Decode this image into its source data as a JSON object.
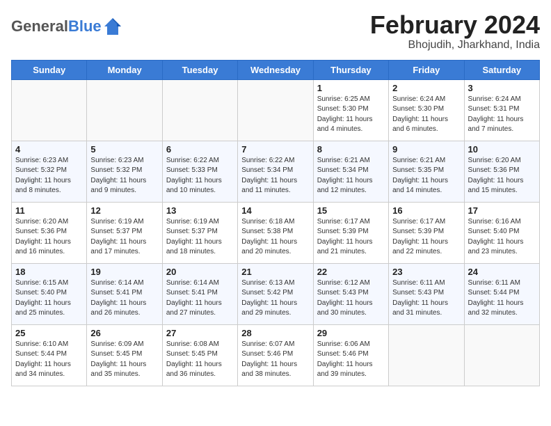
{
  "logo": {
    "general": "General",
    "blue": "Blue"
  },
  "title": "February 2024",
  "subtitle": "Bhojudih, Jharkhand, India",
  "headers": [
    "Sunday",
    "Monday",
    "Tuesday",
    "Wednesday",
    "Thursday",
    "Friday",
    "Saturday"
  ],
  "weeks": [
    [
      {
        "day": "",
        "info": ""
      },
      {
        "day": "",
        "info": ""
      },
      {
        "day": "",
        "info": ""
      },
      {
        "day": "",
        "info": ""
      },
      {
        "day": "1",
        "info": "Sunrise: 6:25 AM\nSunset: 5:30 PM\nDaylight: 11 hours\nand 4 minutes."
      },
      {
        "day": "2",
        "info": "Sunrise: 6:24 AM\nSunset: 5:30 PM\nDaylight: 11 hours\nand 6 minutes."
      },
      {
        "day": "3",
        "info": "Sunrise: 6:24 AM\nSunset: 5:31 PM\nDaylight: 11 hours\nand 7 minutes."
      }
    ],
    [
      {
        "day": "4",
        "info": "Sunrise: 6:23 AM\nSunset: 5:32 PM\nDaylight: 11 hours\nand 8 minutes."
      },
      {
        "day": "5",
        "info": "Sunrise: 6:23 AM\nSunset: 5:32 PM\nDaylight: 11 hours\nand 9 minutes."
      },
      {
        "day": "6",
        "info": "Sunrise: 6:22 AM\nSunset: 5:33 PM\nDaylight: 11 hours\nand 10 minutes."
      },
      {
        "day": "7",
        "info": "Sunrise: 6:22 AM\nSunset: 5:34 PM\nDaylight: 11 hours\nand 11 minutes."
      },
      {
        "day": "8",
        "info": "Sunrise: 6:21 AM\nSunset: 5:34 PM\nDaylight: 11 hours\nand 12 minutes."
      },
      {
        "day": "9",
        "info": "Sunrise: 6:21 AM\nSunset: 5:35 PM\nDaylight: 11 hours\nand 14 minutes."
      },
      {
        "day": "10",
        "info": "Sunrise: 6:20 AM\nSunset: 5:36 PM\nDaylight: 11 hours\nand 15 minutes."
      }
    ],
    [
      {
        "day": "11",
        "info": "Sunrise: 6:20 AM\nSunset: 5:36 PM\nDaylight: 11 hours\nand 16 minutes."
      },
      {
        "day": "12",
        "info": "Sunrise: 6:19 AM\nSunset: 5:37 PM\nDaylight: 11 hours\nand 17 minutes."
      },
      {
        "day": "13",
        "info": "Sunrise: 6:19 AM\nSunset: 5:37 PM\nDaylight: 11 hours\nand 18 minutes."
      },
      {
        "day": "14",
        "info": "Sunrise: 6:18 AM\nSunset: 5:38 PM\nDaylight: 11 hours\nand 20 minutes."
      },
      {
        "day": "15",
        "info": "Sunrise: 6:17 AM\nSunset: 5:39 PM\nDaylight: 11 hours\nand 21 minutes."
      },
      {
        "day": "16",
        "info": "Sunrise: 6:17 AM\nSunset: 5:39 PM\nDaylight: 11 hours\nand 22 minutes."
      },
      {
        "day": "17",
        "info": "Sunrise: 6:16 AM\nSunset: 5:40 PM\nDaylight: 11 hours\nand 23 minutes."
      }
    ],
    [
      {
        "day": "18",
        "info": "Sunrise: 6:15 AM\nSunset: 5:40 PM\nDaylight: 11 hours\nand 25 minutes."
      },
      {
        "day": "19",
        "info": "Sunrise: 6:14 AM\nSunset: 5:41 PM\nDaylight: 11 hours\nand 26 minutes."
      },
      {
        "day": "20",
        "info": "Sunrise: 6:14 AM\nSunset: 5:41 PM\nDaylight: 11 hours\nand 27 minutes."
      },
      {
        "day": "21",
        "info": "Sunrise: 6:13 AM\nSunset: 5:42 PM\nDaylight: 11 hours\nand 29 minutes."
      },
      {
        "day": "22",
        "info": "Sunrise: 6:12 AM\nSunset: 5:43 PM\nDaylight: 11 hours\nand 30 minutes."
      },
      {
        "day": "23",
        "info": "Sunrise: 6:11 AM\nSunset: 5:43 PM\nDaylight: 11 hours\nand 31 minutes."
      },
      {
        "day": "24",
        "info": "Sunrise: 6:11 AM\nSunset: 5:44 PM\nDaylight: 11 hours\nand 32 minutes."
      }
    ],
    [
      {
        "day": "25",
        "info": "Sunrise: 6:10 AM\nSunset: 5:44 PM\nDaylight: 11 hours\nand 34 minutes."
      },
      {
        "day": "26",
        "info": "Sunrise: 6:09 AM\nSunset: 5:45 PM\nDaylight: 11 hours\nand 35 minutes."
      },
      {
        "day": "27",
        "info": "Sunrise: 6:08 AM\nSunset: 5:45 PM\nDaylight: 11 hours\nand 36 minutes."
      },
      {
        "day": "28",
        "info": "Sunrise: 6:07 AM\nSunset: 5:46 PM\nDaylight: 11 hours\nand 38 minutes."
      },
      {
        "day": "29",
        "info": "Sunrise: 6:06 AM\nSunset: 5:46 PM\nDaylight: 11 hours\nand 39 minutes."
      },
      {
        "day": "",
        "info": ""
      },
      {
        "day": "",
        "info": ""
      }
    ]
  ]
}
